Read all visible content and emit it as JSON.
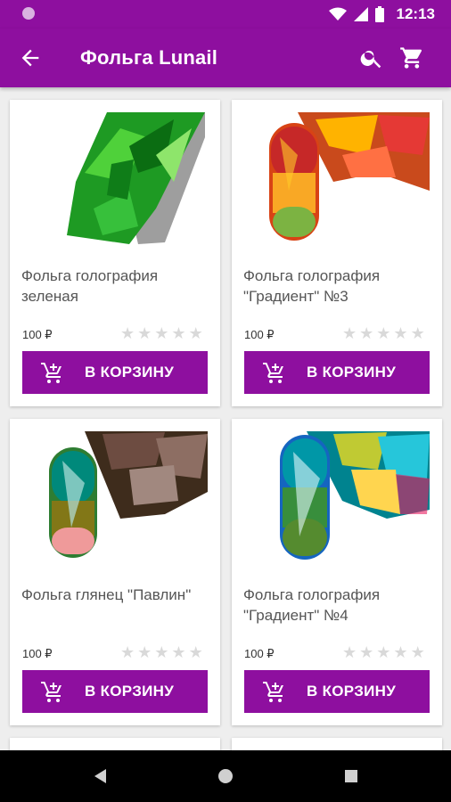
{
  "status_bar": {
    "time": "12:13",
    "icons": [
      "notification-dot-icon",
      "wifi-icon",
      "signal-icon",
      "battery-icon"
    ]
  },
  "app_bar": {
    "title": "Фольга Lunail",
    "back_icon": "arrow-back-icon",
    "search_icon": "search-icon",
    "cart_icon": "cart-icon"
  },
  "products": [
    {
      "name": "Фольга голография зеленая",
      "price": "100 ₽",
      "rating": 0,
      "button": "В КОРЗИНУ",
      "image": "green-holographic-foil"
    },
    {
      "name": "Фольга голография \"Градиент\" №3",
      "price": "100 ₽",
      "rating": 0,
      "button": "В КОРЗИНУ",
      "image": "gradient-foil-nail-3"
    },
    {
      "name": "Фольга глянец \"Павлин\"",
      "price": "100 ₽",
      "rating": 0,
      "button": "В КОРЗИНУ",
      "image": "peacock-foil-nail"
    },
    {
      "name": "Фольга голография \"Градиент\" №4",
      "price": "100 ₽",
      "rating": 0,
      "button": "В КОРЗИНУ",
      "image": "gradient-foil-nail-4"
    }
  ],
  "colors": {
    "primary": "#8e0f9f",
    "star_empty": "#d9d9d9",
    "background": "#eeeeee"
  }
}
